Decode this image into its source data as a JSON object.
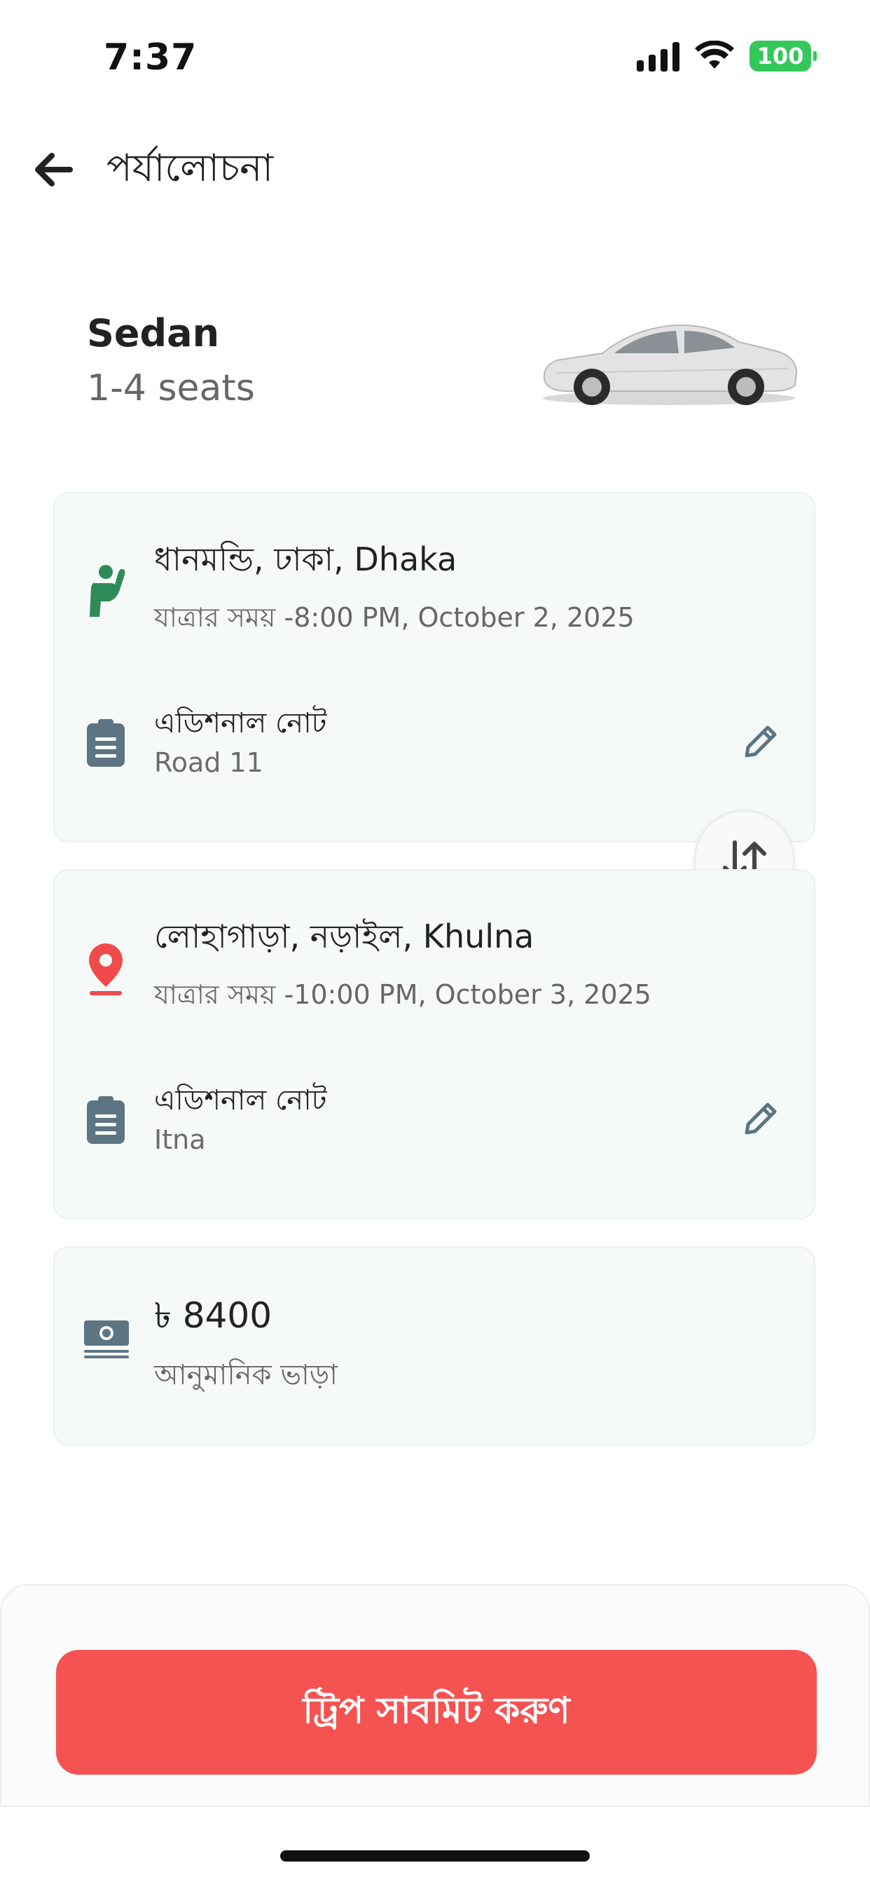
{
  "status_bar": {
    "time": "7:37",
    "battery": "100"
  },
  "header": {
    "title": "পর্যালোচনা"
  },
  "vehicle": {
    "name": "Sedan",
    "seats": "1-4 seats",
    "image_icon": "sedan-car-icon"
  },
  "pickup": {
    "location": "ধানমন্ডি, ঢাকা, Dhaka",
    "time": "যাত্রার সময় -8:00 PM, October 2, 2025",
    "note_label": "এডিশনাল নোট",
    "note_value": "Road 11",
    "icon": "pickup-person-icon",
    "accent_color": "#2e8b57"
  },
  "dropoff": {
    "location": "লোহাগাড়া, নড়াইল, Khulna",
    "time": "যাত্রার সময় -10:00 PM, October 3, 2025",
    "note_label": "এডিশনাল নোট",
    "note_value": "Itna",
    "icon": "location-pin-icon",
    "accent_color": "#f04a4a"
  },
  "fare": {
    "amount": "৳ 8400",
    "label": "আনুমানিক ভাড়া",
    "icon": "cash-icon"
  },
  "actions": {
    "submit_label": "ট্রিপ সাবমিট করুণ"
  },
  "colors": {
    "primary": "#f55252",
    "card_bg": "#f5f9f7",
    "icon_slate": "#5d7482"
  }
}
